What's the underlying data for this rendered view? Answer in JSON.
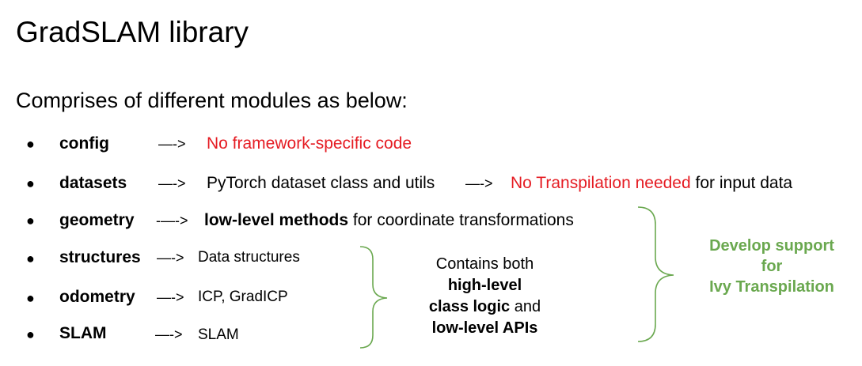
{
  "title": "GradSLAM library",
  "subtitle": "Comprises of different modules as below:",
  "bullet_glyph": "●",
  "modules": [
    {
      "name": "config",
      "arrow": "—->",
      "text_red": "No framework-specific code"
    },
    {
      "name": "datasets",
      "arrow": "—->",
      "text": "PyTorch dataset class and utils",
      "arrow2": "—->",
      "text_red": "No Transpilation needed",
      "text_after": " for input data"
    },
    {
      "name": "geometry",
      "arrow": "-—->",
      "text_bold": "low-level methods",
      "text_after": " for coordinate transformations"
    },
    {
      "name": "structures",
      "arrow": "—->",
      "text": "Data structures"
    },
    {
      "name": "odometry",
      "arrow": "—->",
      "text": "ICP, GradICP"
    },
    {
      "name": "SLAM",
      "arrow": "—->",
      "text": "SLAM"
    }
  ],
  "center_note": {
    "line1": "Contains both",
    "line2": "high-level",
    "line3_bold": "class logic",
    "line3_after": " and",
    "line4": "low-level APIs"
  },
  "green_note": {
    "line1": "Develop support",
    "line2": "for",
    "line3": "Ivy Transpilation"
  },
  "colors": {
    "red": "#e51c23",
    "green": "#6aa84f"
  }
}
